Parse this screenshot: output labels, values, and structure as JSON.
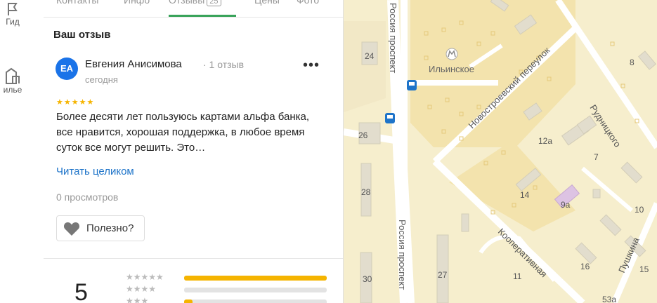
{
  "nav": {
    "guide_label": "Гид",
    "housing_label": "илье"
  },
  "tabs": {
    "items": [
      "Контакты",
      "Инфо",
      "Отзывы",
      "Цены",
      "Фото"
    ],
    "reviews_count": "25"
  },
  "section": {
    "title": "Ваш отзыв"
  },
  "review": {
    "avatar_initials": "ЕА",
    "author": "Евгения Анисимова",
    "author_reviews": "· 1 отзыв",
    "date": "сегодня",
    "more": "•••",
    "stars": "★★★★★",
    "text": "Более десяти лет пользуюсь картами альфа банка, все нравится, хорошая поддержка, в любое время суток все могут решить. Это…",
    "read_more": "Читать целиком",
    "views": "0 просмотров",
    "useful": "Полезно?"
  },
  "rating": {
    "value": "5",
    "rows": [
      {
        "stars": "★★★★★",
        "fraction": 1.0
      },
      {
        "stars": "★★★★",
        "fraction": 0.0
      },
      {
        "stars": "★★★",
        "fraction": 0.06
      }
    ]
  },
  "map": {
    "colors": {
      "land": "#f6eecd",
      "block": "#f3e3ad",
      "road": "#ffffff",
      "building": "#e2ddcd",
      "transit": "#1e74c9"
    },
    "labels": {
      "street_rossiya_1": "Россия проспект",
      "street_rossiya_2": "Россия проспект",
      "street_novostroevsky": "Новостроевский переулок",
      "street_rudnitskogo": "Рудницкого",
      "street_kooperativnaya": "Кооперативная",
      "street_pushkina": "Пушкина",
      "place_ilinskoe": "Ильинское",
      "house_24": "24",
      "house_26": "26",
      "house_28": "28",
      "house_30": "30",
      "house_27": "27",
      "house_8": "8",
      "house_12a": "12а",
      "house_7": "7",
      "house_14": "14",
      "house_9a": "9а",
      "house_10": "10",
      "house_11": "11",
      "house_16": "16",
      "house_15": "15",
      "house_53a": "53а"
    }
  }
}
